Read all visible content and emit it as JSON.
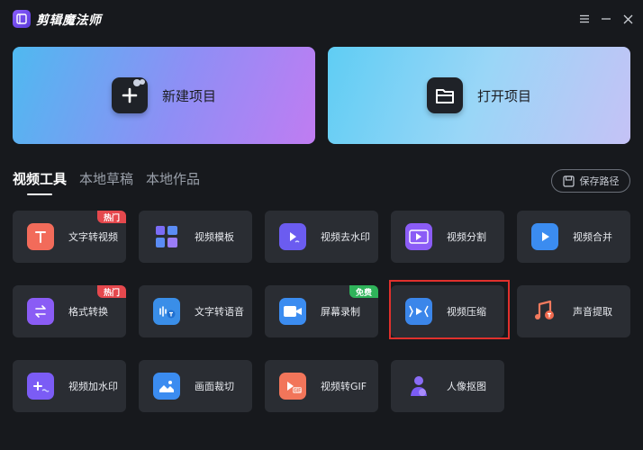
{
  "app": {
    "title": "剪辑魔法师"
  },
  "window_controls": [
    "menu-icon",
    "minimize-icon",
    "close-icon"
  ],
  "actions": {
    "new_project": "新建项目",
    "open_project": "打开项目"
  },
  "tabs": [
    {
      "label": "视频工具",
      "active": true
    },
    {
      "label": "本地草稿",
      "active": false
    },
    {
      "label": "本地作品",
      "active": false
    }
  ],
  "save_path": {
    "label": "保存路径"
  },
  "tools": [
    {
      "label": "文字转视频",
      "icon": "text-video-icon",
      "badge": "热门",
      "badge_color": "#e5484d"
    },
    {
      "label": "视频模板",
      "icon": "template-icon"
    },
    {
      "label": "视频去水印",
      "icon": "remove-watermark-icon"
    },
    {
      "label": "视频分割",
      "icon": "film-split-icon"
    },
    {
      "label": "视频合并",
      "icon": "merge-icon"
    },
    {
      "label": "格式转换",
      "icon": "format-convert-icon",
      "badge": "热门",
      "badge_color": "#e5484d"
    },
    {
      "label": "文字转语音",
      "icon": "text-to-speech-icon"
    },
    {
      "label": "屏幕录制",
      "icon": "screen-record-icon",
      "badge": "免费",
      "badge_color": "#2fb35a"
    },
    {
      "label": "视频压缩",
      "icon": "compress-icon",
      "highlighted": true
    },
    {
      "label": "声音提取",
      "icon": "audio-extract-icon"
    },
    {
      "label": "视频加水印",
      "icon": "add-watermark-icon"
    },
    {
      "label": "画面裁切",
      "icon": "crop-icon"
    },
    {
      "label": "视频转GIF",
      "icon": "gif-icon"
    },
    {
      "label": "人像抠图",
      "icon": "portrait-cutout-icon"
    }
  ]
}
